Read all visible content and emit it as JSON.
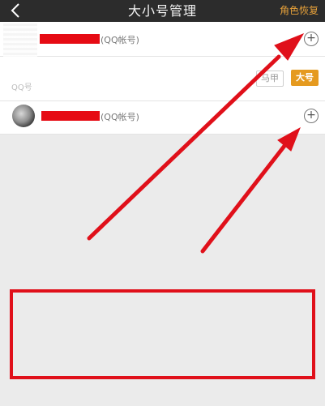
{
  "header": {
    "title": "大小号管理",
    "restore_label": "角色恢复"
  },
  "accounts": [
    {
      "type_label": "(QQ帐号)"
    },
    {
      "faint_label": "QQ号",
      "vest_label": "马甲",
      "main_label": "大号"
    },
    {
      "type_label": "(QQ帐号)"
    }
  ],
  "icons": {
    "back": "chevron-left-icon",
    "add": "plus-circle-icon"
  },
  "annotation_color": "#e0101a"
}
